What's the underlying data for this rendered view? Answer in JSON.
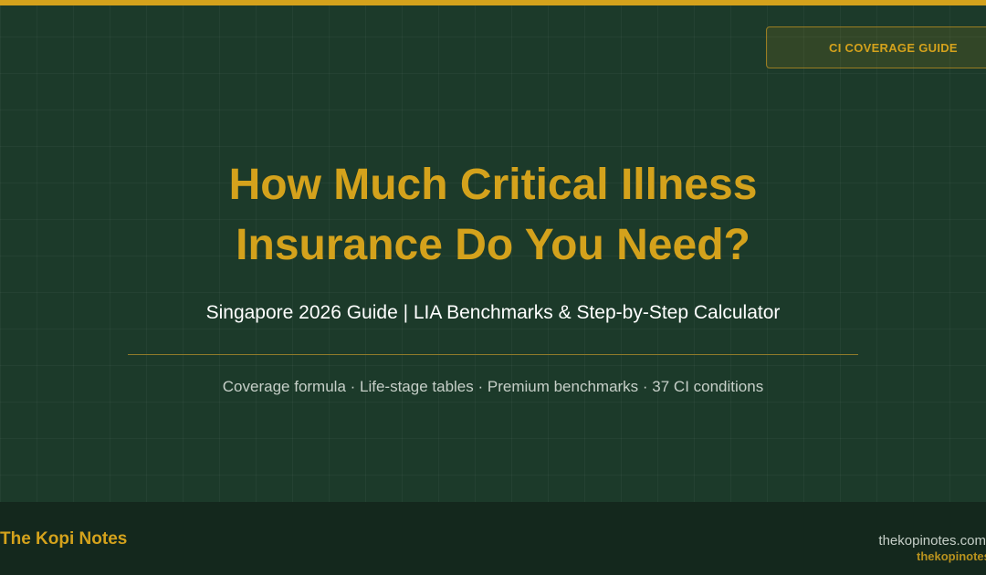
{
  "badge": {
    "label": "CI COVERAGE GUIDE"
  },
  "hero": {
    "title_line1": "How Much Critical Illness",
    "title_line2": "Insurance Do You Need?",
    "subtitle": "Singapore 2026 Guide | LIA Benchmarks & Step-by-Step Calculator",
    "features": "Coverage formula · Life-stage tables · Premium benchmarks · 37 CI conditions"
  },
  "footer": {
    "brand": "The Kopi Notes",
    "site": "thekopinotes.com",
    "site_watermark": "thekopinotes"
  },
  "colors": {
    "background": "#1c3a2a",
    "accent": "#d4a21c",
    "footer_background": "#14281d"
  }
}
